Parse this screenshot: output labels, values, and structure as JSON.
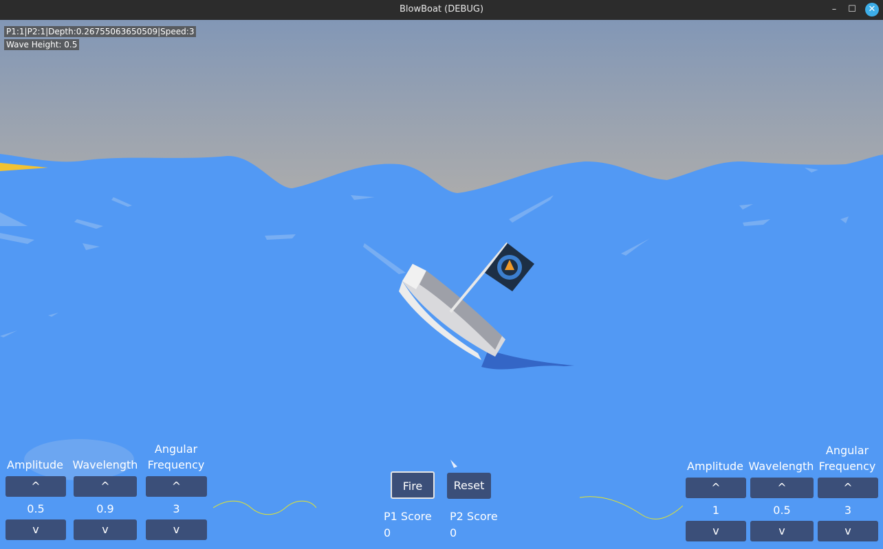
{
  "window": {
    "title": "BlowBoat (DEBUG)"
  },
  "debug": {
    "line1": "P1:1|P2:1|Depth:0.26755063650509|Speed:3",
    "line2": "Wave Height: 0.5"
  },
  "left_panel": {
    "amplitude_label": "Amplitude",
    "wavelength_label": "Wavelength",
    "angular_label_1": "Angular",
    "angular_label_2": "Frequency",
    "up": "^",
    "down": "v",
    "amplitude": "0.5",
    "wavelength": "0.9",
    "angular_frequency": "3"
  },
  "right_panel": {
    "amplitude_label": "Amplitude",
    "wavelength_label": "Wavelength",
    "angular_label_1": "Angular",
    "angular_label_2": "Frequency",
    "up": "^",
    "down": "v",
    "amplitude": "1",
    "wavelength": "0.5",
    "angular_frequency": "3"
  },
  "center": {
    "fire_label": "Fire",
    "reset_label": "Reset",
    "p1_score_label": "P1 Score",
    "p2_score_label": "P2 Score",
    "p1_score": "0",
    "p2_score": "0"
  },
  "colors": {
    "sky": "#8a9cb4",
    "sea": "#5299f4",
    "button": "#3b4f79",
    "wave_line": "#e6e62a"
  }
}
